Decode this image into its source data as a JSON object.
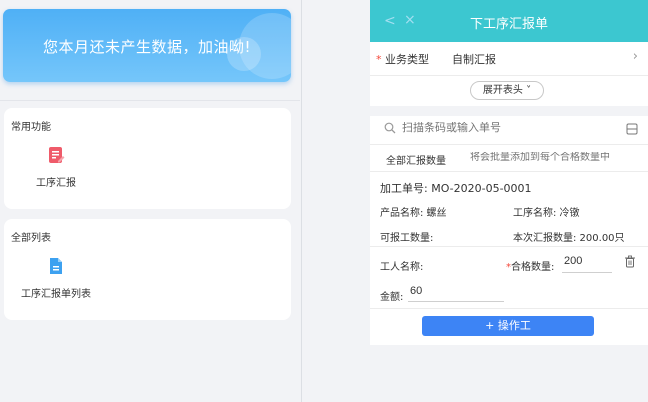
{
  "banner": {
    "message": "您本月还未产生数据，加油呦!"
  },
  "common_functions": {
    "title": "常用功能",
    "items": [
      {
        "label": "工序汇报",
        "icon": "report-edit-icon"
      }
    ]
  },
  "all_lists": {
    "title": "全部列表",
    "items": [
      {
        "label": "工序汇报单列表",
        "icon": "document-list-icon"
      }
    ]
  },
  "form": {
    "nav": {
      "back_glyph": "<",
      "close_glyph": "×",
      "title": "下工序汇报单"
    },
    "business_type": {
      "required_mark": "*",
      "label": "业务类型",
      "value": "自制汇报",
      "arrow": "›"
    },
    "expand_button": "展开表头 ˅",
    "search": {
      "placeholder": "扫描条码或输入单号"
    },
    "batch": {
      "label": "全部汇报数量",
      "placeholder": "将会批量添加到每个合格数量中"
    },
    "order": {
      "order_no": "加工单号: MO-2020-05-0001",
      "product": "产品名称: 螺丝",
      "process": "工序名称: 冷镦",
      "reportable": "可报工数量:",
      "this_report": "本次汇报数量: 200.00只"
    },
    "worker": {
      "label": "工人名称:",
      "value": ""
    },
    "qualified": {
      "required_mark": "*",
      "label": "合格数量:",
      "value": "200"
    },
    "amount": {
      "label": "金额:",
      "value": "60"
    },
    "add_worker_button": "+ 操作工"
  },
  "colors": {
    "nav_bar": "#3cc7d0",
    "primary_button": "#3d84f5",
    "banner_gradient_start": "#4fb0f6",
    "banner_gradient_end": "#75c6fa",
    "required": "#f5483b"
  }
}
